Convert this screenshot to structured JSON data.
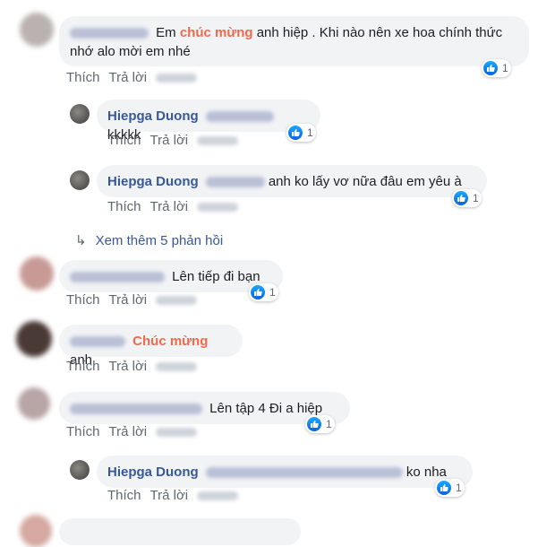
{
  "labels": {
    "like": "Thích",
    "reply": "Trả lời",
    "time": "2 ngày"
  },
  "comments": [
    {
      "author": "",
      "before": "Em ",
      "highlight": "chúc mừng",
      "after": " anh hiệp . Khi nào nên xe hoa chính thức",
      "line2": "nhớ alo mời em nhé",
      "reactions": "1"
    },
    {
      "author": "Hiepga Duong",
      "text": "kkkkk",
      "reactions": "1"
    },
    {
      "author": "Hiepga Duong",
      "text": "anh ko lấy vơ nữa đâu em yêu à",
      "reactions": "1"
    },
    {
      "author": "",
      "text": "Lên tiếp đi bạn",
      "reactions": "1"
    },
    {
      "author": "",
      "highlight": "Chúc mừng",
      "after": " anh"
    },
    {
      "author": "",
      "text": "Lên tập 4 Đi a hiệp",
      "reactions": "1"
    },
    {
      "author": "Hiepga Duong",
      "text": "ko nha",
      "reactions": "1"
    }
  ],
  "more_replies": "Xem thêm 5 phản hồi"
}
